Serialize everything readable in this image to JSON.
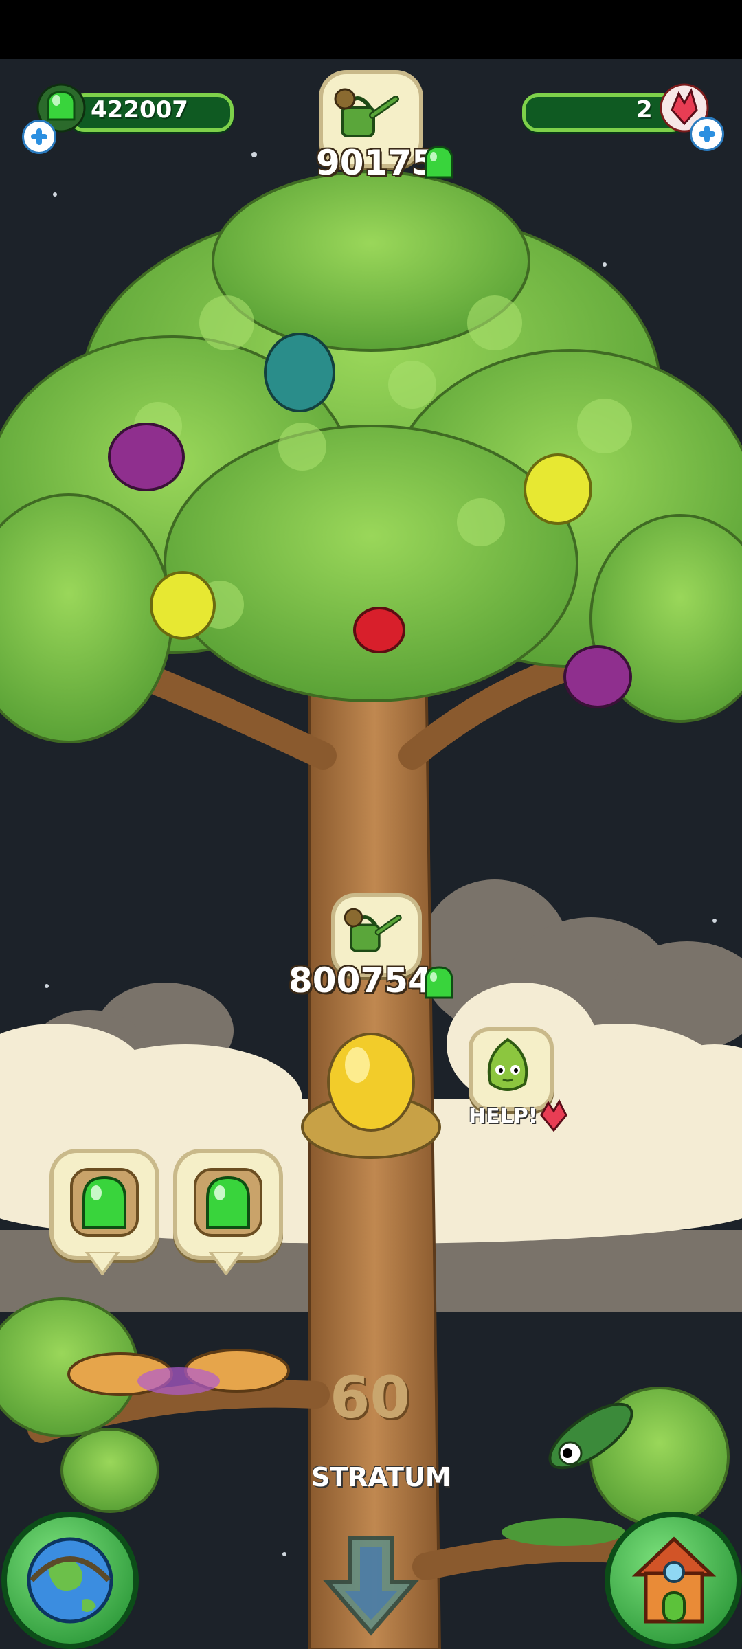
{
  "hud": {
    "gems_value": "422007",
    "crystals_value": "2",
    "top_water_cost": "90175"
  },
  "tree": {
    "water_cost": "800754",
    "stratum_number": "60",
    "stratum_label": "STRATUM",
    "help_label": "HELP!"
  },
  "icons": {
    "gem": "green-gem-icon",
    "crystal": "red-crystal-icon",
    "watering_can": "watering-can-icon",
    "globe": "globe-icon",
    "house": "house-icon",
    "down_arrow": "down-arrow-icon"
  },
  "colors": {
    "sky": "#1c2229",
    "leaf": "#8fce4c",
    "trunk": "#b07845",
    "hud_green": "#0f5a22"
  }
}
